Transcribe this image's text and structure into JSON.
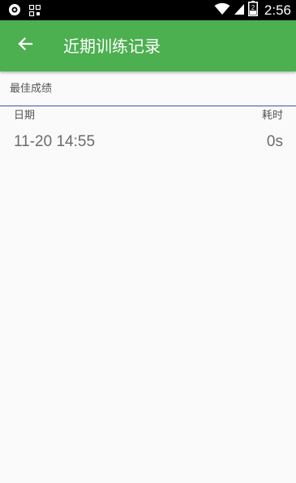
{
  "status_bar": {
    "time": "2:56",
    "icons": [
      "notification-icon",
      "qr-grid-icon",
      "wifi-icon",
      "cell-signal-icon",
      "battery-icon"
    ],
    "battery_number": "2"
  },
  "app_bar": {
    "title": "近期训练记录",
    "back_icon": "arrow-back-icon",
    "background_color": "#4caf50"
  },
  "best_section": {
    "label": "最佳成绩"
  },
  "table": {
    "headers": {
      "date": "日期",
      "duration": "耗时"
    },
    "rows": [
      {
        "date": "11-20 14:55",
        "duration": "0s"
      }
    ]
  },
  "colors": {
    "divider": "#3f51b5",
    "page_background": "#fafafa"
  }
}
